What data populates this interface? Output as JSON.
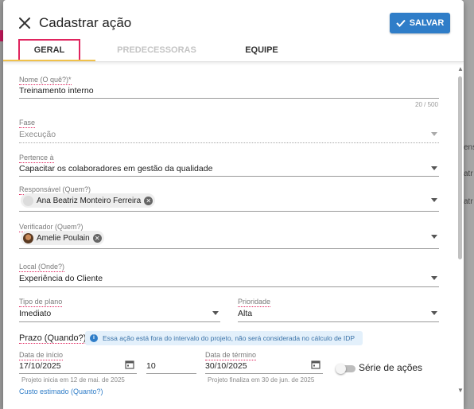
{
  "background": {
    "peek_texts": [
      "ensa",
      "atr",
      "atr"
    ],
    "left_peek": "p"
  },
  "dialog": {
    "title": "Cadastrar ação",
    "save_label": "SALVAR",
    "close_icon": "close-icon",
    "colors": {
      "primary": "#2f7dc8",
      "tab_highlight": "#e0245e",
      "tab_underline": "#f0c14b"
    }
  },
  "tabs": [
    {
      "label": "GERAL",
      "active": true
    },
    {
      "label": "PREDECESSORAS",
      "active": false,
      "disabled": true
    },
    {
      "label": "EQUIPE",
      "active": false
    }
  ],
  "form": {
    "nome": {
      "label": "Nome (O quê?)*",
      "value": "Treinamento interno",
      "counter": "20 / 500"
    },
    "fase": {
      "label": "Fase",
      "value": "Execução",
      "disabled": true
    },
    "pertence": {
      "label": "Pertence à",
      "value": "Capacitar os colaboradores em gestão da qualidade"
    },
    "responsavel": {
      "label": "Responsável (Quem?)",
      "chip": "Ana Beatriz Monteiro Ferreira"
    },
    "verificador": {
      "label": "Verificador (Quem?)",
      "chip": "Amelie Poulain"
    },
    "local": {
      "label": "Local (Onde?)",
      "value": "Experiência do Cliente"
    },
    "tipo_plano": {
      "label": "Tipo de plano",
      "value": "Imediato"
    },
    "prioridade": {
      "label": "Prioridade",
      "value": "Alta"
    },
    "prazo": {
      "title": "Prazo (Quando?)",
      "info": "Essa ação está fora do intervalo do projeto, não será considerada no cálculo de IDP",
      "data_inicio": {
        "label": "Data de início",
        "value": "17/10/2025",
        "hint": "Projeto inicia em 12 de mai. de 2025"
      },
      "duracao": {
        "value": "10"
      },
      "data_termino": {
        "label": "Data de término",
        "value": "30/10/2025",
        "hint": "Projeto finaliza em 30 de jun. de 2025"
      },
      "serie_label": "Série de ações",
      "serie_on": false
    },
    "custo_link": "Custo estimado (Quanto?)"
  }
}
